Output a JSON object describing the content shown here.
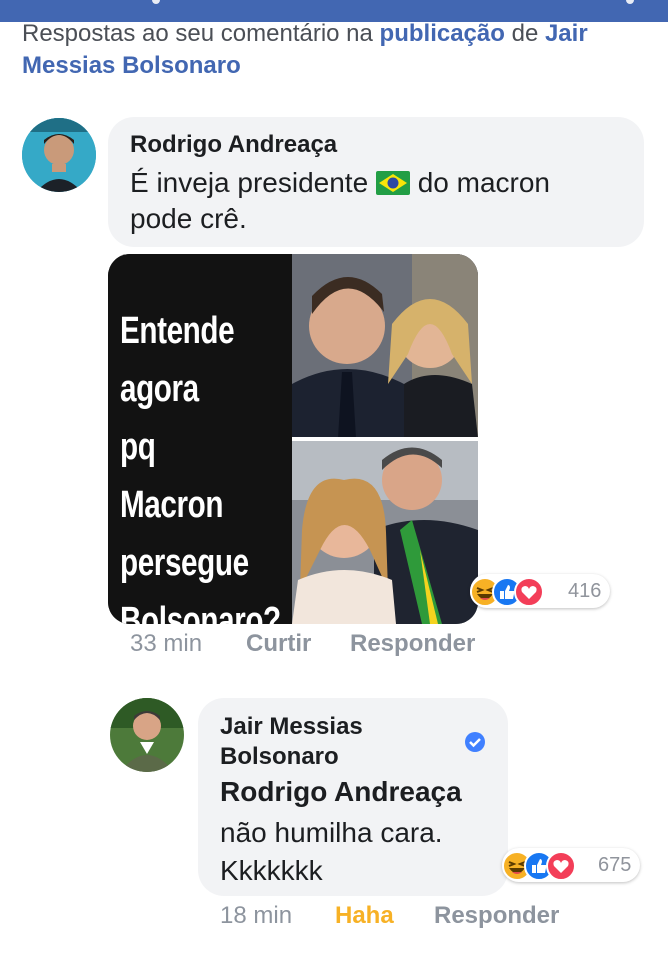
{
  "header": {
    "prefix": "Respostas ao seu comentário na ",
    "link_publication": "publicação",
    "connector": " de ",
    "link_author": "Jair Messias Bolsonaro"
  },
  "comment1": {
    "author": "Rodrigo Andreaça",
    "text_before_flag": "É inveja presidente ",
    "text_after_flag": " do macron",
    "text_line2": "pode crê.",
    "meme_lines": [
      "Entende",
      "agora",
      "pq Macron",
      "persegue",
      "Bolsonaro?"
    ],
    "reaction_count": "416",
    "time": "33 min",
    "like_label": "Curtir",
    "reply_label": "Responder",
    "reaction_icons": [
      "haha-icon",
      "like-icon",
      "love-icon"
    ]
  },
  "reply1": {
    "author_line1": "Jair Messias",
    "author_line2": "Bolsonaro",
    "mention": "Rodrigo Andreaça",
    "text_line1": "não humilha cara.",
    "text_line2": "Kkkkkkk",
    "reaction_count": "675",
    "time": "18 min",
    "reacted_label": "Haha",
    "reply_label": "Responder",
    "reaction_icons": [
      "haha-icon",
      "like-icon",
      "love-icon"
    ]
  },
  "colors": {
    "brand": "#4267b2",
    "link": "#4267b2",
    "meta": "#8d949e",
    "haha_reacted": "#f7b125",
    "bubble": "#f2f3f5",
    "verified": "#4080ff"
  }
}
